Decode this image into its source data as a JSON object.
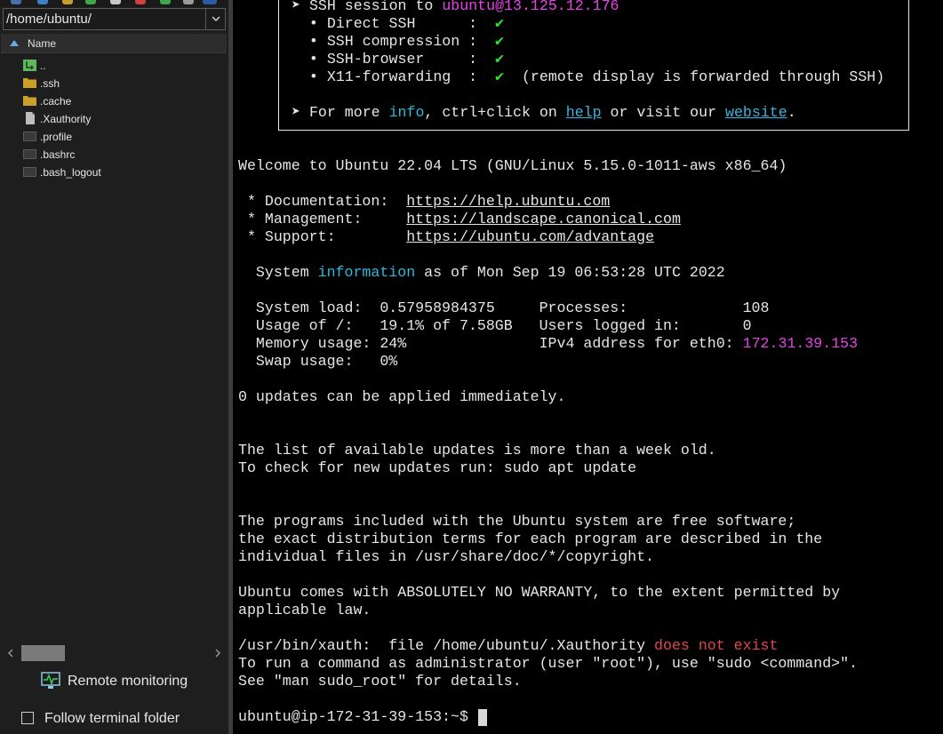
{
  "file_panel": {
    "path": "/home/ubuntu/",
    "column_header": "Name",
    "files": [
      {
        "name": "..",
        "icon": "parent-folder-icon"
      },
      {
        "name": ".ssh",
        "icon": "folder-icon"
      },
      {
        "name": ".cache",
        "icon": "folder-icon"
      },
      {
        "name": ".Xauthority",
        "icon": "file-icon"
      },
      {
        "name": ".profile",
        "icon": "script-file-icon"
      },
      {
        "name": ".bashrc",
        "icon": "script-file-icon"
      },
      {
        "name": ".bash_logout",
        "icon": "script-file-icon"
      }
    ],
    "remote_monitoring": "Remote monitoring",
    "follow_terminal_folder": "Follow terminal folder"
  },
  "terminal": {
    "banner": {
      "ssh_session_prefix": "➤ SSH session to ",
      "ssh_session_target": "ubuntu@13.125.12.176",
      "features": [
        {
          "label": "  • Direct SSH      :  ",
          "check": "✔",
          "note": ""
        },
        {
          "label": "  • SSH compression :  ",
          "check": "✔",
          "note": ""
        },
        {
          "label": "  • SSH-browser     :  ",
          "check": "✔",
          "note": ""
        },
        {
          "label": "  • X11-forwarding  :  ",
          "check": "✔",
          "note": "  (remote display is forwarded through SSH)"
        }
      ],
      "more_prefix": "➤ For more ",
      "more_info": "info",
      "more_mid1": ", ctrl+click on ",
      "more_help": "help",
      "more_mid2": " or visit our ",
      "more_website": "website",
      "more_end": "."
    },
    "welcome": "Welcome to Ubuntu 22.04 LTS (GNU/Linux 5.15.0-1011-aws x86_64)",
    "docs_label": " * Documentation:  ",
    "docs_url": "https://help.ubuntu.com",
    "mgmt_label": " * Management:     ",
    "mgmt_url": "https://landscape.canonical.com",
    "support_label": " * Support:        ",
    "support_url": "https://ubuntu.com/advantage",
    "sysinfo_prefix": "  System ",
    "sysinfo_word": "information",
    "sysinfo_suffix": " as of Mon Sep 19 06:53:28 UTC 2022",
    "stats": {
      "load_line": "  System load:  0.57958984375     Processes:             108",
      "usage_line": "  Usage of /:   19.1% of 7.58GB   Users logged in:       0",
      "memory_line": "  Memory usage: 24%               IPv4 address for eth0: ",
      "ipv4": "172.31.39.153",
      "swap_line": "  Swap usage:   0%"
    },
    "updates": "0 updates can be applied immediately.",
    "list_old": "The list of available updates is more than a week old.",
    "check_updates": "To check for new updates run: sudo apt update",
    "programs_1": "The programs included with the Ubuntu system are free software;",
    "programs_2": "the exact distribution terms for each program are described in the",
    "programs_3": "individual files in /usr/share/doc/*/copyright.",
    "warranty_1": "Ubuntu comes with ABSOLUTELY NO WARRANTY, to the extent permitted by",
    "warranty_2": "applicable law.",
    "xauth_prefix": "/usr/bin/xauth:  file /home/ubuntu/.Xauthority ",
    "xauth_error": "does not exist",
    "sudo_1": "To run a command as administrator (user \"root\"), use \"sudo <command>\".",
    "sudo_2": "See \"man sudo_root\" for details.",
    "prompt": "ubuntu@ip-172-31-39-153:~$ "
  },
  "colors": {
    "magenta": "#e644e6",
    "cyan": "#2fb8d8",
    "green": "#2ee82e",
    "red": "#e04848"
  }
}
